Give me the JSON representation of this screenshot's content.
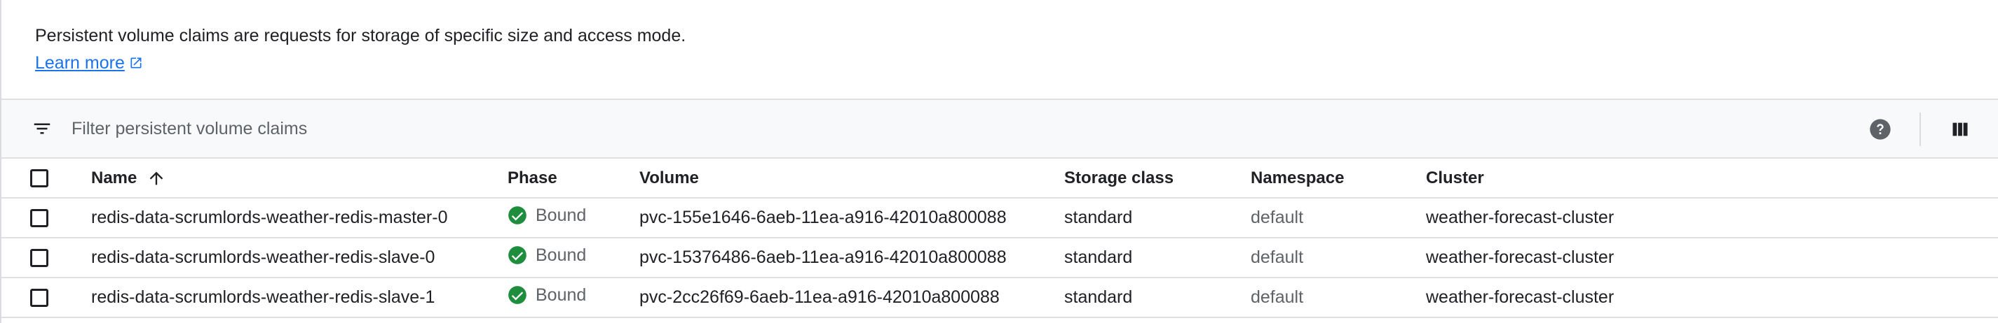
{
  "intro": {
    "description": "Persistent volume claims are requests for storage of specific size and access mode.",
    "learn_more": "Learn more"
  },
  "toolbar": {
    "filter_placeholder": "Filter persistent volume claims",
    "filter_value": ""
  },
  "table": {
    "columns": {
      "name": "Name",
      "phase": "Phase",
      "volume": "Volume",
      "storage_class": "Storage class",
      "namespace": "Namespace",
      "cluster": "Cluster"
    },
    "sort": {
      "column": "Name",
      "direction": "ascending"
    },
    "rows": [
      {
        "name": "redis-data-scrumlords-weather-redis-master-0",
        "phase": "Bound",
        "volume": "pvc-155e1646-6aeb-11ea-a916-42010a800088",
        "storage_class": "standard",
        "namespace": "default",
        "cluster": "weather-forecast-cluster"
      },
      {
        "name": "redis-data-scrumlords-weather-redis-slave-0",
        "phase": "Bound",
        "volume": "pvc-15376486-6aeb-11ea-a916-42010a800088",
        "storage_class": "standard",
        "namespace": "default",
        "cluster": "weather-forecast-cluster"
      },
      {
        "name": "redis-data-scrumlords-weather-redis-slave-1",
        "phase": "Bound",
        "volume": "pvc-2cc26f69-6aeb-11ea-a916-42010a800088",
        "storage_class": "standard",
        "namespace": "default",
        "cluster": "weather-forecast-cluster"
      }
    ]
  },
  "colors": {
    "link": "#1a73e8",
    "status_ok": "#1e8e3e",
    "muted_text": "#5f6368",
    "toolbar_bg": "#f8f9fa"
  },
  "icons": {
    "filter": "filter-icon",
    "external_link": "open-in-new-icon",
    "sort": "arrow-upward-icon",
    "status": "check-circle-icon",
    "help": "help-icon",
    "columns": "view-column-icon"
  }
}
